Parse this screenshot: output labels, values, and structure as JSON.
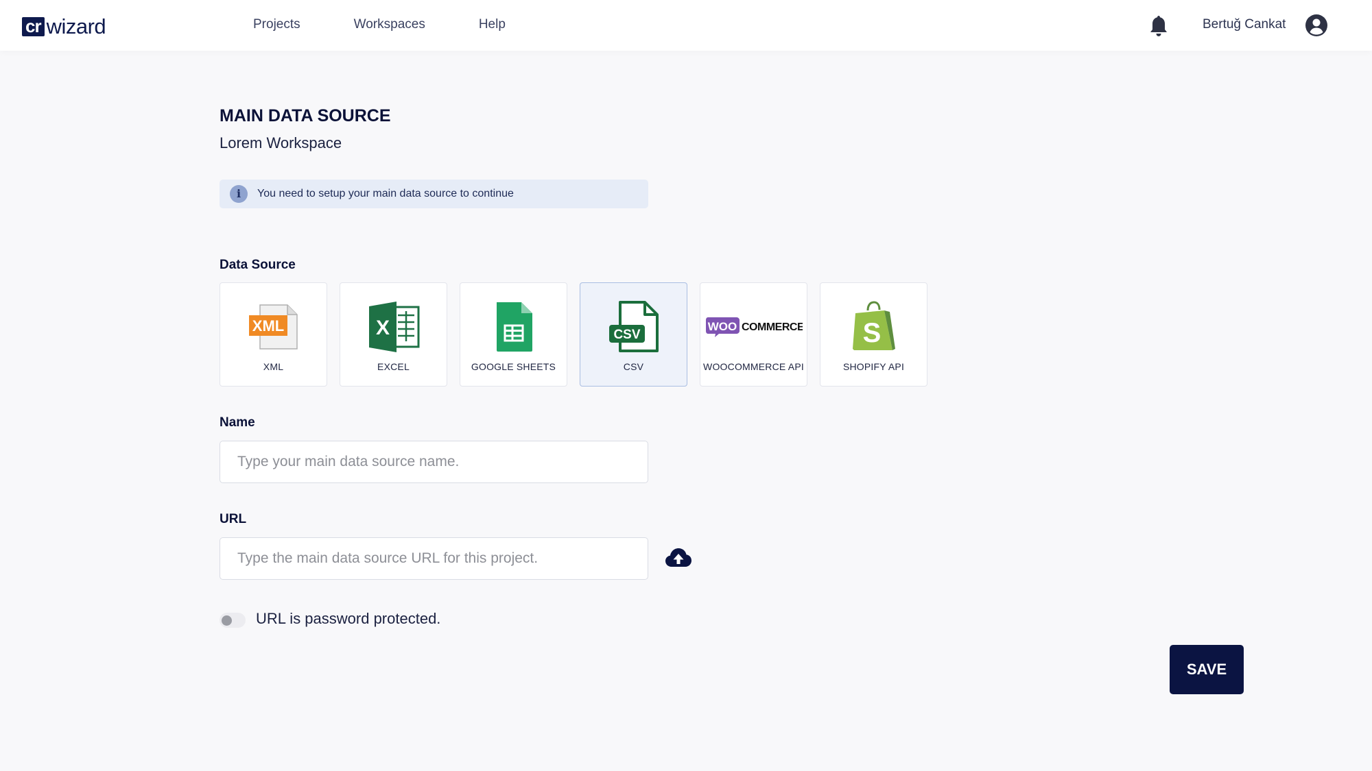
{
  "header": {
    "logo_mark": "cr",
    "logo_text": "wizard",
    "nav": [
      "Projects",
      "Workspaces",
      "Help"
    ],
    "user_name": "Bertuğ Cankat",
    "icons": [
      "bell-icon",
      "user-avatar-icon"
    ]
  },
  "page": {
    "title": "MAIN DATA SOURCE",
    "subtitle": "Lorem Workspace",
    "notice": "You need to setup your main data source to continue",
    "notice_icon": "i"
  },
  "data_source": {
    "label": "Data Source",
    "selected": "CSV",
    "options": [
      {
        "label": "XML",
        "icon": "xml-file-icon"
      },
      {
        "label": "EXCEL",
        "icon": "excel-icon"
      },
      {
        "label": "GOOGLE SHEETS",
        "icon": "google-sheets-icon"
      },
      {
        "label": "CSV",
        "icon": "csv-file-icon"
      },
      {
        "label": "WOOCOMMERCE API",
        "icon": "woocommerce-icon"
      },
      {
        "label": "SHOPIFY API",
        "icon": "shopify-icon"
      }
    ]
  },
  "name_field": {
    "label": "Name",
    "value": "",
    "placeholder": "Type your main data source name."
  },
  "url_field": {
    "label": "URL",
    "value": "",
    "placeholder": "Type the main data source URL for this project."
  },
  "password_toggle": {
    "label": "URL is password protected.",
    "on": false
  },
  "save_label": "SAVE",
  "colors": {
    "brand": "#0e1a4d",
    "primary_button": "#0b1442",
    "notice_bg": "#e6ecf7",
    "selected_card_bg": "#eef2fa"
  }
}
